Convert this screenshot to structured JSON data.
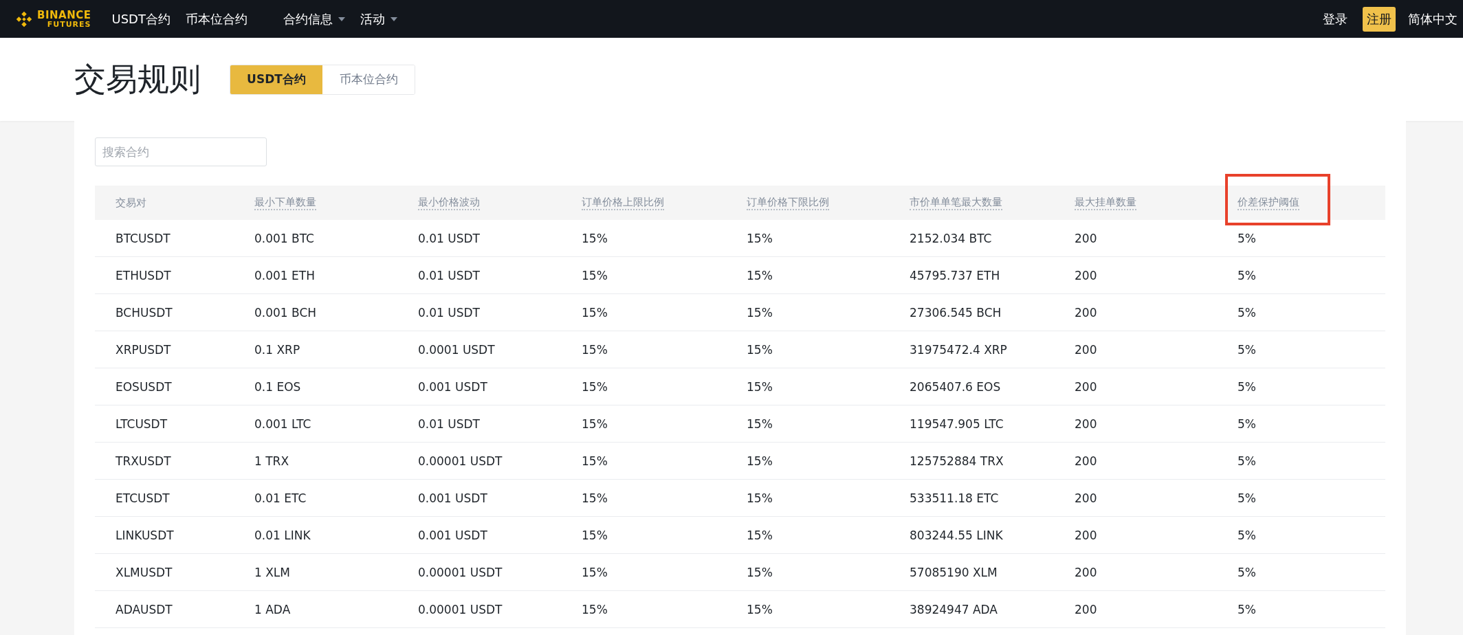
{
  "nav": {
    "logo_top": "BINANCE",
    "logo_bottom": "FUTURES",
    "links": [
      {
        "label": "USDT合约",
        "dropdown": false
      },
      {
        "label": "币本位合约",
        "dropdown": false
      },
      {
        "label": "合约信息",
        "dropdown": true
      },
      {
        "label": "活动",
        "dropdown": true
      }
    ],
    "login": "登录",
    "register": "注册",
    "language": "简体中文"
  },
  "page_title": "交易规则",
  "tabs": [
    {
      "label": "USDT合约",
      "selected": true
    },
    {
      "label": "币本位合约",
      "selected": false
    }
  ],
  "search": {
    "placeholder": "搜索合约"
  },
  "table": {
    "columns": [
      {
        "label": "交易对",
        "underlined": false,
        "highlighted": false
      },
      {
        "label": "最小下单数量",
        "underlined": true,
        "highlighted": false
      },
      {
        "label": "最小价格波动",
        "underlined": true,
        "highlighted": false
      },
      {
        "label": "订单价格上限比例",
        "underlined": true,
        "highlighted": false
      },
      {
        "label": "订单价格下限比例",
        "underlined": true,
        "highlighted": false
      },
      {
        "label": "市价单单笔最大数量",
        "underlined": true,
        "highlighted": false
      },
      {
        "label": "最大挂单数量",
        "underlined": true,
        "highlighted": false
      },
      {
        "label": "价差保护阈值",
        "underlined": true,
        "highlighted": true
      }
    ],
    "rows": [
      [
        "BTCUSDT",
        "0.001 BTC",
        "0.01 USDT",
        "15%",
        "15%",
        "2152.034 BTC",
        "200",
        "5%"
      ],
      [
        "ETHUSDT",
        "0.001 ETH",
        "0.01 USDT",
        "15%",
        "15%",
        "45795.737 ETH",
        "200",
        "5%"
      ],
      [
        "BCHUSDT",
        "0.001 BCH",
        "0.01 USDT",
        "15%",
        "15%",
        "27306.545 BCH",
        "200",
        "5%"
      ],
      [
        "XRPUSDT",
        "0.1 XRP",
        "0.0001 USDT",
        "15%",
        "15%",
        "31975472.4 XRP",
        "200",
        "5%"
      ],
      [
        "EOSUSDT",
        "0.1 EOS",
        "0.001 USDT",
        "15%",
        "15%",
        "2065407.6 EOS",
        "200",
        "5%"
      ],
      [
        "LTCUSDT",
        "0.001 LTC",
        "0.01 USDT",
        "15%",
        "15%",
        "119547.905 LTC",
        "200",
        "5%"
      ],
      [
        "TRXUSDT",
        "1 TRX",
        "0.00001 USDT",
        "15%",
        "15%",
        "125752884 TRX",
        "200",
        "5%"
      ],
      [
        "ETCUSDT",
        "0.01 ETC",
        "0.001 USDT",
        "15%",
        "15%",
        "533511.18 ETC",
        "200",
        "5%"
      ],
      [
        "LINKUSDT",
        "0.01 LINK",
        "0.001 USDT",
        "15%",
        "15%",
        "803244.55 LINK",
        "200",
        "5%"
      ],
      [
        "XLMUSDT",
        "1 XLM",
        "0.00001 USDT",
        "15%",
        "15%",
        "57085190 XLM",
        "200",
        "5%"
      ],
      [
        "ADAUSDT",
        "1 ADA",
        "0.00001 USDT",
        "15%",
        "15%",
        "38924947 ADA",
        "200",
        "5%"
      ]
    ]
  }
}
